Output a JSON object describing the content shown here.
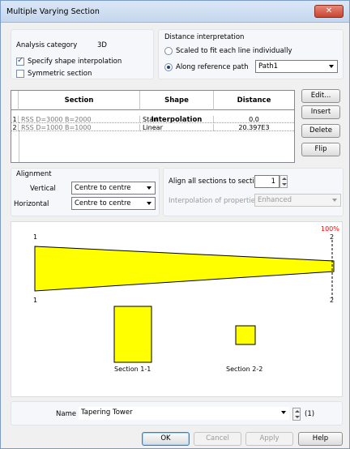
{
  "window": {
    "title": "Multiple Varying Section",
    "close_glyph": "✕"
  },
  "analysis": {
    "label": "Analysis category",
    "value": "3D"
  },
  "options": {
    "specify_shape_interpolation": {
      "label": "Specify shape interpolation",
      "checked": true
    },
    "symmetric_section": {
      "label": "Symmetric section",
      "checked": false
    }
  },
  "distance": {
    "group_label": "Distance interpretation",
    "scaled_label": "Scaled to fit each line individually",
    "along_path_label": "Along reference path",
    "selected": "along_path",
    "path_value": "Path1"
  },
  "table": {
    "headers": [
      "Section",
      "Shape Interpolation",
      "Distance"
    ],
    "rows": [
      {
        "num": "1",
        "section": "RSS D=3000 B=2000",
        "interp": "Start",
        "distance": "0.0"
      },
      {
        "num": "2",
        "section": "RSS D=1000 B=1000",
        "interp": "Linear",
        "distance": "20.397E3"
      }
    ]
  },
  "side_buttons": {
    "edit": "Edit...",
    "insert": "Insert",
    "delete": "Delete",
    "flip": "Flip"
  },
  "alignment": {
    "group_label": "Alignment",
    "vertical_label": "Vertical",
    "vertical_value": "Centre to centre",
    "horizontal_label": "Horizontal",
    "horizontal_value": "Centre to centre",
    "align_all_label": "Align all sections to section",
    "align_all_value": "1",
    "interp_props_label": "Interpolation of properties",
    "interp_props_value": "Enhanced"
  },
  "preview": {
    "percent_label": "100%",
    "top_left_num": "1",
    "top_right_num": "2",
    "bottom_left_num": "1",
    "bottom_right_num": "2",
    "section1_label": "Section 1-1",
    "section2_label": "Section 2-2",
    "fill_color": "#ffff00",
    "percent_color": "#ff0000"
  },
  "name_field": {
    "label": "Name",
    "value": "Tapering Tower",
    "counter": "(1)"
  },
  "footer": {
    "ok": "OK",
    "cancel": "Cancel",
    "apply": "Apply",
    "help": "Help"
  }
}
